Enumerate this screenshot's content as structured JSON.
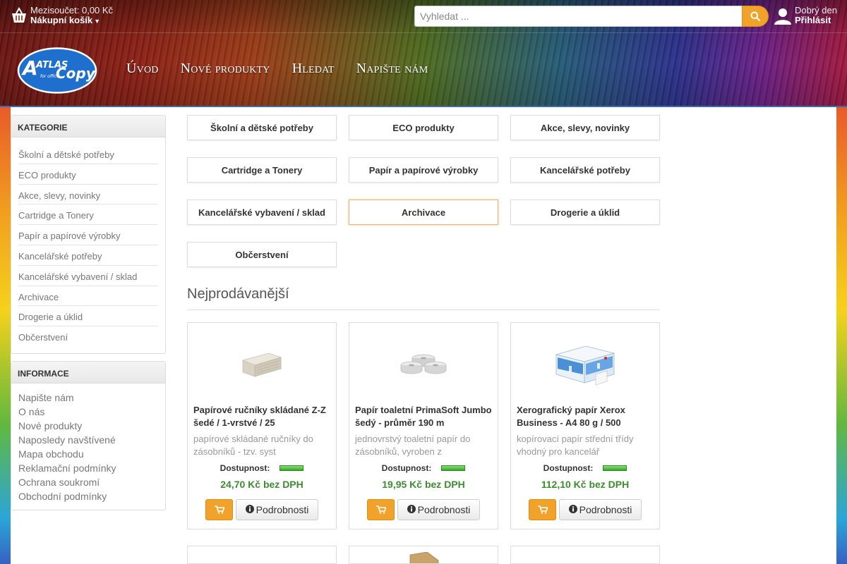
{
  "cart": {
    "subtotal": "Mezisoučet: 0,00 Kč",
    "label": "Nákupní košík"
  },
  "search": {
    "placeholder": "Vyhledat ..."
  },
  "user": {
    "greeting": "Dobrý den",
    "login": "Přihlásit"
  },
  "logo": {
    "line1": "ATLAS",
    "line2": "Copy",
    "tagline": "for office"
  },
  "nav": [
    "Úvod",
    "Nové produkty",
    "Hledat",
    "Napište nám"
  ],
  "sidebar": {
    "categories_title": "KATEGORIE",
    "categories": [
      "Školní a dětské potřeby",
      "ECO produkty",
      "Akce, slevy, novinky",
      "Cartridge a Tonery",
      "Papír a papírové výrobky",
      "Kancelářské potřeby",
      "Kancelářské vybavení / sklad",
      "Archivace",
      "Drogerie a úklid",
      "Občerstvení"
    ],
    "info_title": "INFORMACE",
    "info": [
      "Napište nám",
      "O nás",
      "Nové produkty",
      "Naposledy navštívené",
      "Mapa obchodu",
      "Reklamační podmínky",
      "Ochrana soukromí",
      "Obchodní podmínky"
    ]
  },
  "category_buttons": [
    "Školní a dětské potřeby",
    "ECO produkty",
    "Akce, slevy, novinky",
    "Cartridge a Tonery",
    "Papír a papírové výrobky",
    "Kancelářské potřeby",
    "Kancelářské vybavení / sklad",
    "Archivace",
    "Drogerie a úklid",
    "Občerstvení"
  ],
  "bestsellers": {
    "title": "Nejprodávanější",
    "availability_label": "Dostupnost:",
    "details_label": "Podrobnosti",
    "products": [
      {
        "name": "Papírové ručníky skládané Z-Z šedé / 1-vrstvé / 25",
        "desc": "papírové skládané ručníky do zásobníků - tzv. syst",
        "price": "24,70 Kč bez DPH",
        "image": "folded-towels-image"
      },
      {
        "name": "Papír toaletní PrimaSoft Jumbo šedý - průměr 190 m",
        "desc": "jednovrstvý toaletní papír do zásobníků, vyroben z",
        "price": "19,95 Kč bez DPH",
        "image": "toilet-paper-rolls-image"
      },
      {
        "name": "Xerografický papír Xerox Business - A4 80 g / 500",
        "desc": "kopírovací papír střední třídy vhodný pro kancelář",
        "price": "112,10 Kč bez DPH",
        "image": "paper-box-image"
      }
    ]
  },
  "colors": {
    "accent_orange": "#f0a22a",
    "price_green": "#3c8d2f",
    "availability_green": "#35a826"
  }
}
